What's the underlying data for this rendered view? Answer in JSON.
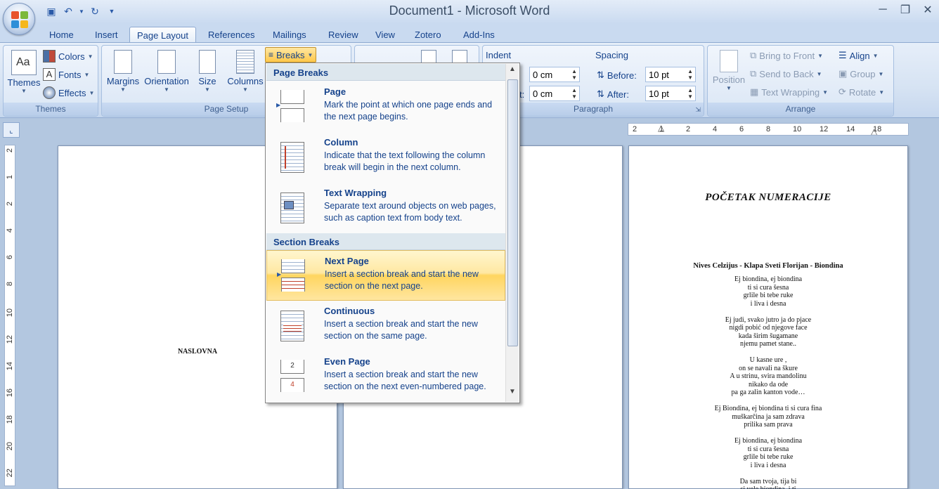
{
  "window": {
    "title": "Document1 - Microsoft Word"
  },
  "qat": {
    "items": [
      "save-icon",
      "undo-icon",
      "redo-icon",
      "customize-icon"
    ]
  },
  "tabs": [
    "Home",
    "Insert",
    "Page Layout",
    "References",
    "Mailings",
    "Review",
    "View",
    "Zotero",
    "Add-Ins"
  ],
  "active_tab": "Page Layout",
  "ribbon": {
    "themes": {
      "themes_label": "Themes",
      "colors_label": "Colors",
      "fonts_label": "Fonts",
      "effects_label": "Effects",
      "group_label": "Themes"
    },
    "page_setup": {
      "margins_label": "Margins",
      "orientation_label": "Orientation",
      "size_label": "Size",
      "columns_label": "Columns",
      "breaks_label": "Breaks",
      "group_label": "Page Setup"
    },
    "paragraph": {
      "indent_label": "Indent",
      "indent_left_label": "t:",
      "indent_left_value": "0 cm",
      "indent_right_value": "0 cm",
      "spacing_label": "Spacing",
      "before_label": "Before:",
      "before_value": "10 pt",
      "after_label": "After:",
      "after_value": "10 pt",
      "group_label": "Paragraph"
    },
    "arrange": {
      "position_label": "Position",
      "bring_front_label": "Bring to Front",
      "send_back_label": "Send to Back",
      "text_wrapping_label": "Text Wrapping",
      "align_label": "Align",
      "group_label_btn": "Group",
      "rotate_label": "Rotate",
      "group_label": "Arrange"
    }
  },
  "breaks_menu": {
    "page_breaks_header": "Page Breaks",
    "section_breaks_header": "Section Breaks",
    "items": [
      {
        "title": "Page",
        "description": "Mark the point at which one page ends and the next page begins."
      },
      {
        "title": "Column",
        "description": "Indicate that the text following the column break will begin in the next column."
      },
      {
        "title": "Text Wrapping",
        "description": "Separate text around objects on web pages, such as caption text from body text."
      },
      {
        "title": "Next Page",
        "description": "Insert a section break and start the new section on the next page."
      },
      {
        "title": "Continuous",
        "description": "Insert a section break and start the new section on the same page."
      },
      {
        "title": "Even Page",
        "description": "Insert a section break and start the new section on the next even-numbered page."
      }
    ],
    "highlighted": "Next Page"
  },
  "hruler": {
    "ticks": [
      "2",
      "1",
      "2",
      "4",
      "6",
      "8",
      "10",
      "12",
      "14",
      "18"
    ]
  },
  "vruler": {
    "ticks": [
      "2",
      "1",
      "2",
      "4",
      "6",
      "8",
      "10",
      "12",
      "14",
      "16",
      "18",
      "20",
      "22"
    ]
  },
  "pages": {
    "page1": {
      "text": "NASLOVNA"
    },
    "page3": {
      "heading": "POČETAK NUMERACIJE",
      "song_title": "Nives Celzijus - Klapa Sveti Florijan - Biondina",
      "lines": [
        "Ej biondina, ej biondina",
        "ti si cura šesna",
        "grlile bi tebe ruke",
        "i liva i desna",
        "",
        "Ej judi, svako jutro ja do pjace",
        "nigdi pobić od njegove face",
        "kada širim šugamane",
        "njemu pamet stane..",
        "",
        "U kasne ure ,",
        "on se navali na škure",
        "A u strinu, svira mandolinu",
        "nikako da ode",
        "pa ga zalin kanton vode…",
        "",
        "Ej Biondina, ej biondina ti si cura fina",
        "muškarčina ja sam zdrava",
        "prilika sam prava",
        "",
        "Ej biondina, ej biondina",
        "ti si cura šesna",
        "grlile bi tebe ruke",
        "i liva i desna",
        "",
        "Da sam tvoja, tija bi",
        "si vele biondina, i ti"
      ]
    }
  }
}
